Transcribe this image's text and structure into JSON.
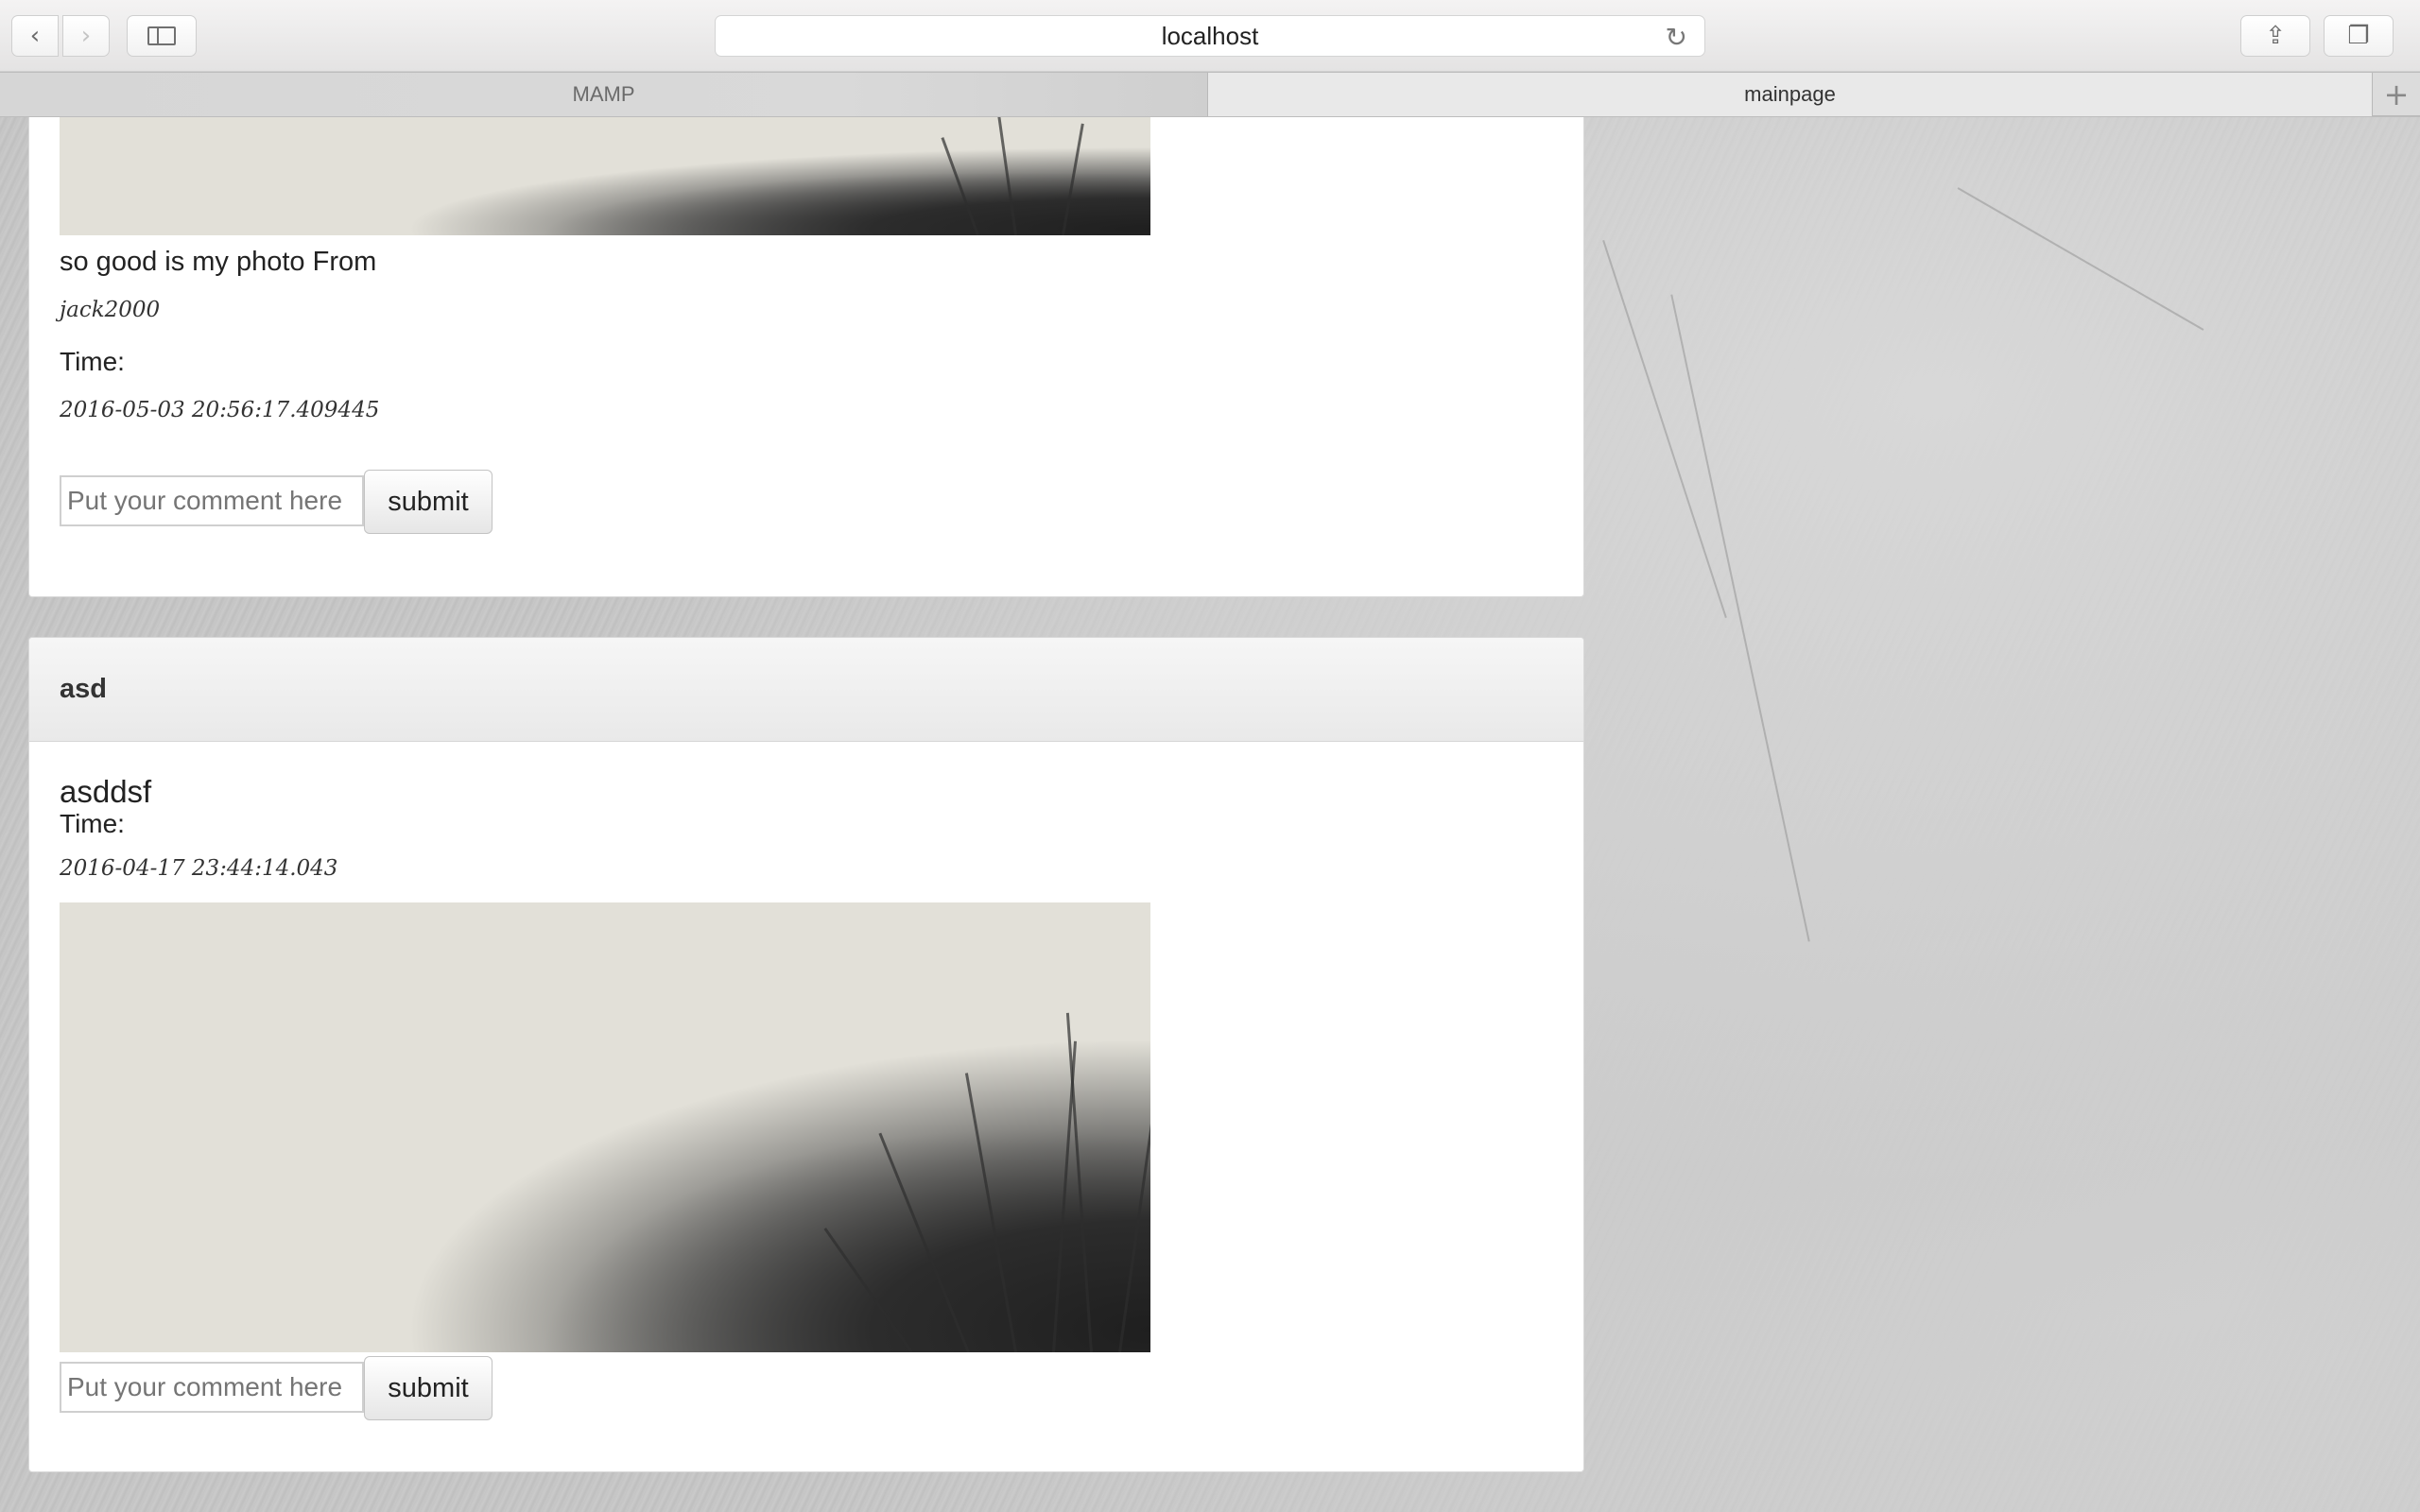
{
  "browser": {
    "back_icon": "chevron-left-icon",
    "forward_icon": "chevron-right-icon",
    "address": "localhost",
    "tabs": [
      {
        "label": "MAMP"
      },
      {
        "label": "mainpage"
      }
    ]
  },
  "posts": [
    {
      "caption": "so good is my photo From",
      "author": "jack2000",
      "time_label": "Time:",
      "timestamp": "2016-05-03 20:56:17.409445",
      "comment_placeholder": "Put your comment here",
      "submit_label": "submit"
    },
    {
      "header": "asd",
      "title": "asddsf",
      "time_label": "Time:",
      "timestamp": "2016-04-17 23:44:14.043",
      "comment_placeholder": "Put your comment here",
      "submit_label": "submit"
    }
  ]
}
